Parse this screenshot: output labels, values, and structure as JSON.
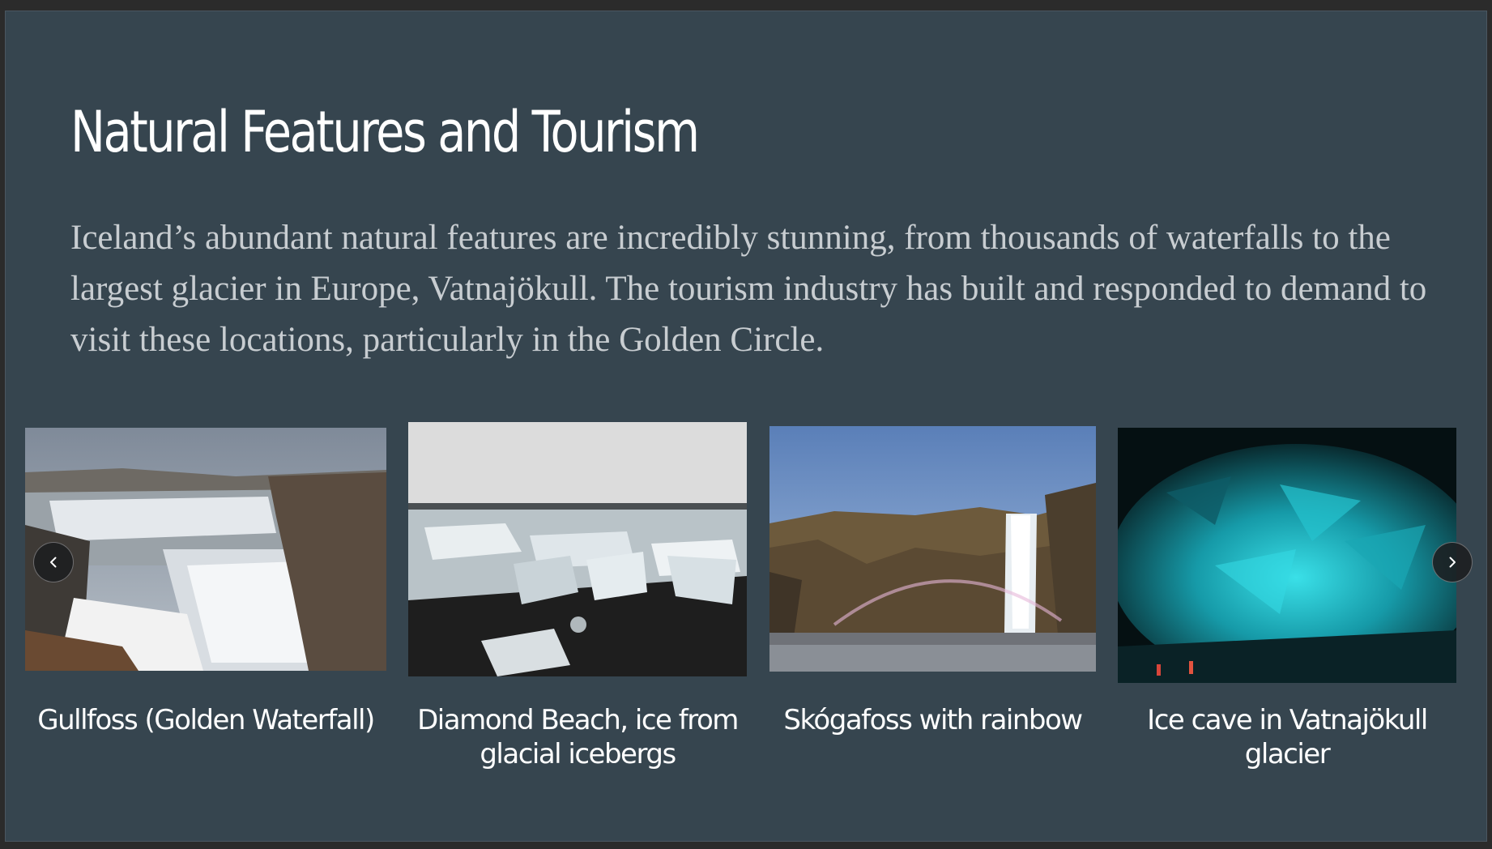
{
  "slide": {
    "title": "Natural Features and Tourism",
    "intro": "Iceland’s abundant natural features are incredibly stunning, from thousands of waterfalls to the largest glacier in Europe, Vatnajökull. The tourism industry has built and responded to demand to visit these locations, particularly in the Golden Circle."
  },
  "gallery": {
    "items": [
      {
        "caption": "Gullfoss (Golden Waterfall)"
      },
      {
        "caption": "Diamond Beach, ice from glacial icebergs"
      },
      {
        "caption": "Skógafoss with rainbow"
      },
      {
        "caption": "Ice cave in Vatnajökull glacier"
      }
    ],
    "prev_icon": "chevron-left-icon",
    "next_icon": "chevron-right-icon"
  },
  "colors": {
    "background": "#36454f",
    "title": "#ffffff",
    "body_text": "#c8cdd1"
  }
}
